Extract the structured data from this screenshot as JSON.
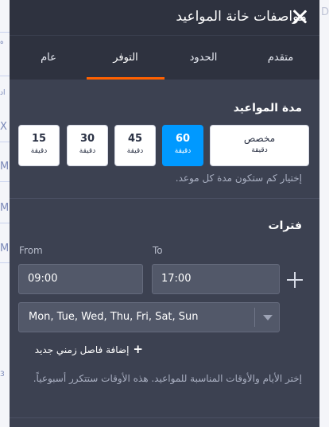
{
  "background": {
    "right_fragment": "D",
    "left_fragments": [
      "ه",
      "اد",
      "X",
      "M",
      "M",
      "M",
      "3"
    ]
  },
  "panel": {
    "title": "مواصفات خانة المواعيد"
  },
  "tabs": [
    {
      "label": "عام",
      "active": false
    },
    {
      "label": "التوفر",
      "active": true
    },
    {
      "label": "الحدود",
      "active": false
    },
    {
      "label": "متقدم",
      "active": false
    }
  ],
  "duration": {
    "title": "مدة المواعيد",
    "options": [
      {
        "value": "15",
        "unit": "دقيقة",
        "active": false
      },
      {
        "value": "30",
        "unit": "دقيقة",
        "active": false
      },
      {
        "value": "45",
        "unit": "دقيقة",
        "active": false
      },
      {
        "value": "60",
        "unit": "دقيقة",
        "active": true
      }
    ],
    "custom": {
      "label": "مخصص",
      "unit": "دقيقة"
    },
    "help": "إختيار كم ستكون مدة كل موعد."
  },
  "intervals": {
    "title": "فترات",
    "from_label": "From",
    "to_label": "To",
    "from_value": "09:00",
    "to_value": "17:00",
    "days_value": "Mon, Tue, Wed, Thu, Fri, Sat, Sun",
    "add_label": "إضافة فاصل زمني جديد",
    "note": "إختر الأيام والأوقات المناسبة للمواعيد. هذه الأوقات ستتكرر أسبوعياً."
  },
  "colors": {
    "panel": "#3c4151",
    "header": "#2e323f",
    "accent": "#ff6100",
    "selected": "#0099ff"
  }
}
